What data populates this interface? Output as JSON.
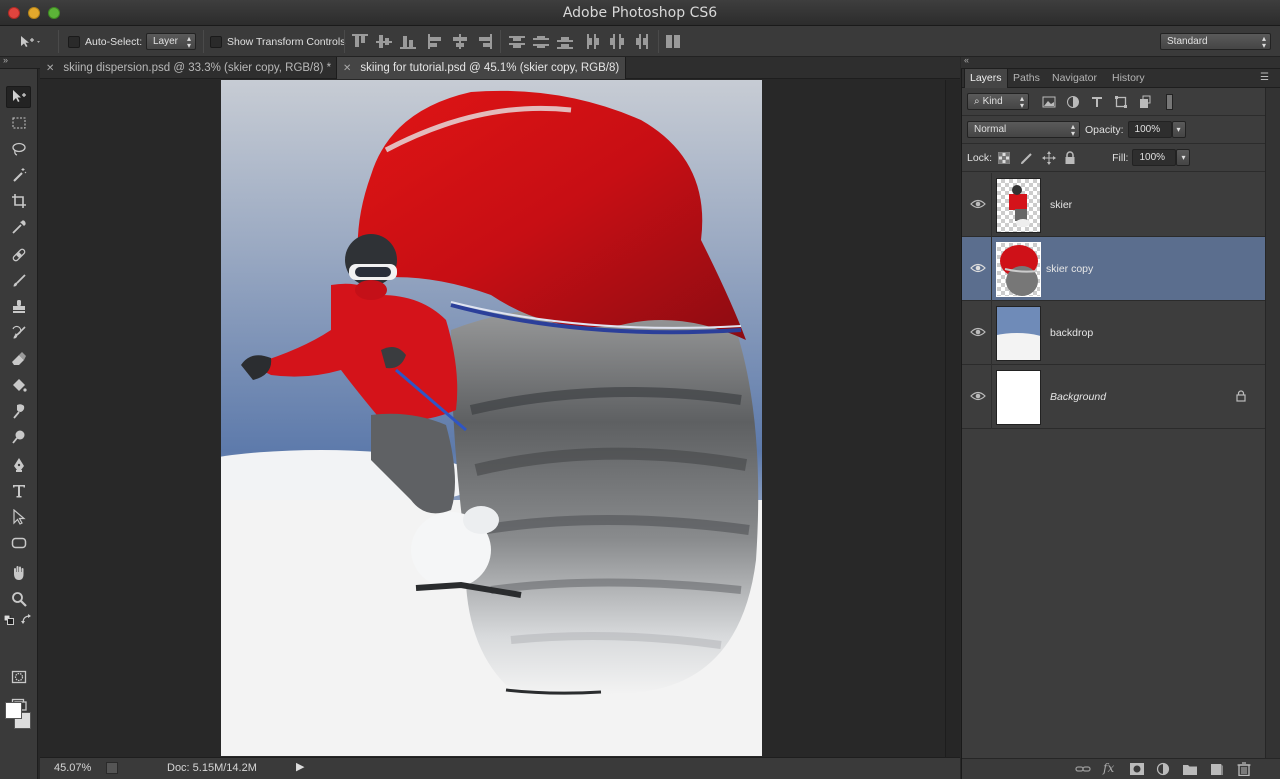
{
  "app": {
    "title": "Adobe Photoshop CS6"
  },
  "options_bar": {
    "auto_select_label": "Auto-Select:",
    "auto_select_value": "Layer",
    "transform_controls_label": "Show Transform Controls",
    "workspace_value": "Standard"
  },
  "tabs": [
    {
      "label": "skiing dispersion.psd @ 33.3% (skier copy, RGB/8) *",
      "active": false
    },
    {
      "label": "skiing for tutorial.psd @ 45.1% (skier copy, RGB/8)",
      "active": true
    }
  ],
  "status": {
    "zoom": "45.07%",
    "doc": "Doc: 5.15M/14.2M"
  },
  "panel": {
    "tabs": [
      "Layers",
      "Paths",
      "Navigator",
      "History"
    ],
    "kind_label": "Kind",
    "blend_mode": "Normal",
    "opacity_label": "Opacity:",
    "opacity_value": "100%",
    "lock_label": "Lock:",
    "fill_label": "Fill:",
    "fill_value": "100%",
    "layers": [
      {
        "name": "skier",
        "selected": false,
        "locked": false
      },
      {
        "name": "skier copy",
        "selected": true,
        "locked": false
      },
      {
        "name": "backdrop",
        "selected": false,
        "locked": false
      },
      {
        "name": "Background",
        "selected": false,
        "locked": true
      }
    ]
  },
  "colors": {
    "selection": "#5b6e8e",
    "panel_bg": "#3d3d3d",
    "app_bg": "#282828"
  }
}
